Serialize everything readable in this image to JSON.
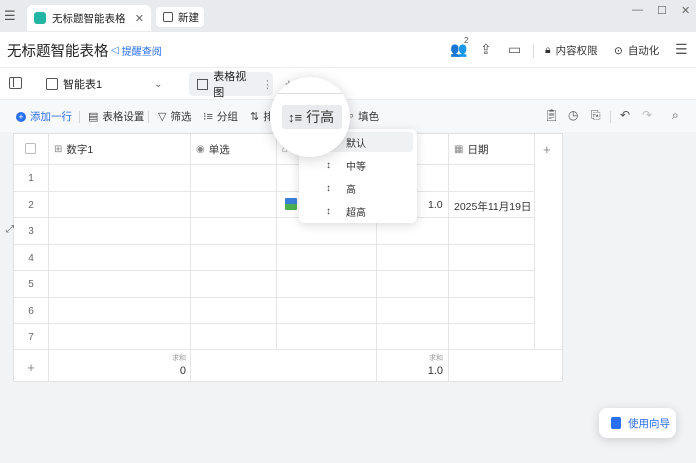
{
  "titlebar": {
    "tab_title": "无标题智能表格",
    "new_tab_label": "新建"
  },
  "header": {
    "doc_title": "无标题智能表格",
    "remind_label": "提醒查阅",
    "collab_count": "2",
    "content_permission": "内容权限",
    "automation": "自动化"
  },
  "sheetbar": {
    "sheet_name": "智能表1",
    "view_name": "表格视图",
    "add": "+"
  },
  "toolbar": {
    "add_row": "添加一行",
    "table_settings": "表格设置",
    "filter": "筛选",
    "group": "分组",
    "sort": "排",
    "fill": "填色"
  },
  "grid": {
    "columns": [
      "数字1",
      "单选",
      "",
      "",
      "日期"
    ],
    "row_numbers": [
      "1",
      "2",
      "3",
      "4",
      "5",
      "6",
      "7"
    ],
    "row2_value": "1.0",
    "row2_date": "2025年11月19日",
    "add_row_symbol": "+",
    "add_col_symbol": "+",
    "sum_label": "求和",
    "sum_col1": "0",
    "sum_col4": "1.0"
  },
  "menu": {
    "items": [
      "默认",
      "中等",
      "高",
      "超高"
    ],
    "selected": "默认"
  },
  "magnifier": {
    "label": "行高"
  },
  "guide": {
    "label": "使用向导"
  },
  "colors": {
    "accent": "#2a6ff0",
    "brand_logo": "#22b5a3"
  }
}
